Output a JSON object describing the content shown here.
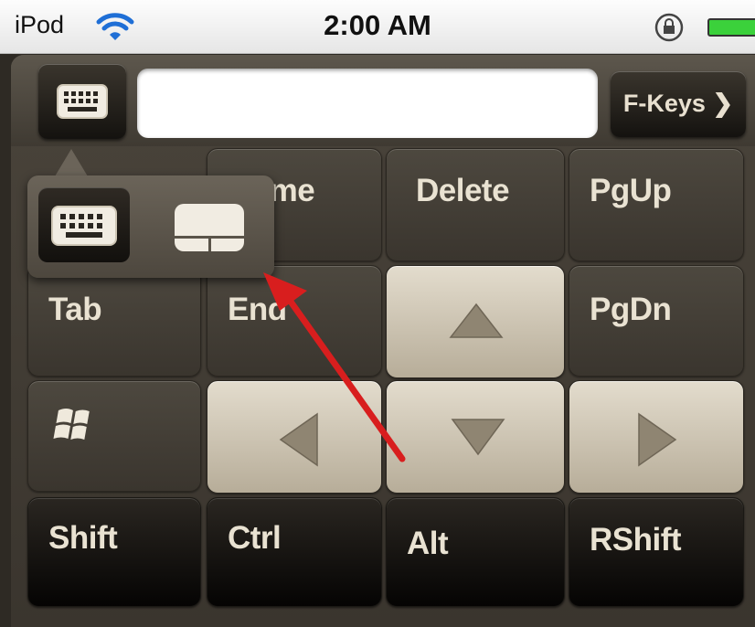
{
  "status_bar": {
    "carrier": "iPod",
    "time": "2:00 AM"
  },
  "toolbar": {
    "text_value": "",
    "fkeys_label": "F-Keys ❯"
  },
  "keys": {
    "home": "Home",
    "delete": "Delete",
    "pgup": "PgUp",
    "tab": "Tab",
    "end": "End",
    "pgdn": "PgDn",
    "shift": "Shift",
    "ctrl": "Ctrl",
    "alt": "Alt",
    "rshift": "RShift"
  },
  "icons": {
    "keyboard_toggle": "keyboard-icon",
    "mode_keyboard": "keyboard-icon",
    "mode_trackpad": "trackpad-icon",
    "windows": "windows-logo-icon",
    "up": "arrow-up-icon",
    "down": "arrow-down-icon",
    "left": "arrow-left-icon",
    "right": "arrow-right-icon",
    "wifi": "wifi-icon",
    "lock": "rotation-lock-icon",
    "battery": "battery-icon"
  },
  "colors": {
    "accent_arrow": "#d81e1e",
    "key_text": "#e9e2d2",
    "light_key": "#cfc6b3",
    "battery": "#3bd13b"
  }
}
